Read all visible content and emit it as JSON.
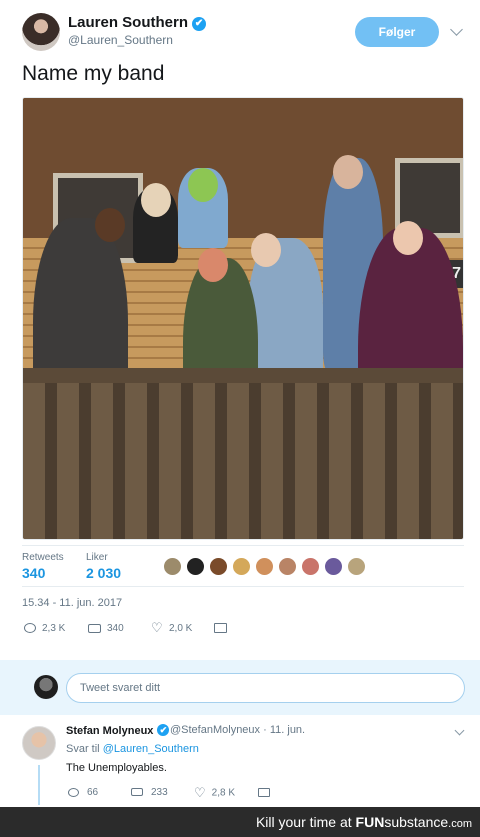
{
  "tweet": {
    "author_name": "Lauren Southern",
    "verified_glyph": "✔",
    "author_handle": "@Lauren_Southern",
    "follow_label": "Følger",
    "text": "Name my band",
    "photo_alt": "",
    "photo_house_number": "67",
    "stats": {
      "retweets_label": "Retweets",
      "retweets_value": "340",
      "likes_label": "Liker",
      "likes_value": "2 030"
    },
    "likers_avatar_colors": [
      "#9c8b6b",
      "#222222",
      "#7a4b2a",
      "#d4a85a",
      "#d0905c",
      "#b98466",
      "#c9746a",
      "#6a5a9c",
      "#b8a47c"
    ],
    "timestamp": "15.34 - 11. jun. 2017",
    "actions": {
      "replies": "2,3 K",
      "retweets": "340",
      "likes": "2,0 K"
    }
  },
  "reply_box": {
    "placeholder": "Tweet svaret ditt"
  },
  "reply": {
    "author_name": "Stefan Molyneux",
    "verified_glyph": "✔",
    "author_handle": "@StefanMolyneux",
    "separator": "·",
    "date": "11. jun.",
    "reply_to_prefix": "Svar til",
    "reply_to_mention": "@Lauren_Southern",
    "text": "The Unemployables.",
    "actions": {
      "replies": "66",
      "retweets": "233",
      "likes": "2,8 K"
    }
  },
  "footer": {
    "prefix": "Kill your time at ",
    "brand_a": "FUN",
    "brand_b": "substance",
    "brand_c": ".com"
  },
  "colors": {
    "accent": "#1da1f2",
    "link": "#1b95e0",
    "follow_button": "#72c0f4",
    "muted_text": "#657786",
    "reply_box_bg": "#e8f5fd",
    "footer_bg": "#2b2b2b"
  },
  "icons": {
    "reply": "reply-icon",
    "retweet": "retweet-icon",
    "like": "heart-icon",
    "dm": "envelope-icon",
    "more": "chevron-down-icon"
  }
}
